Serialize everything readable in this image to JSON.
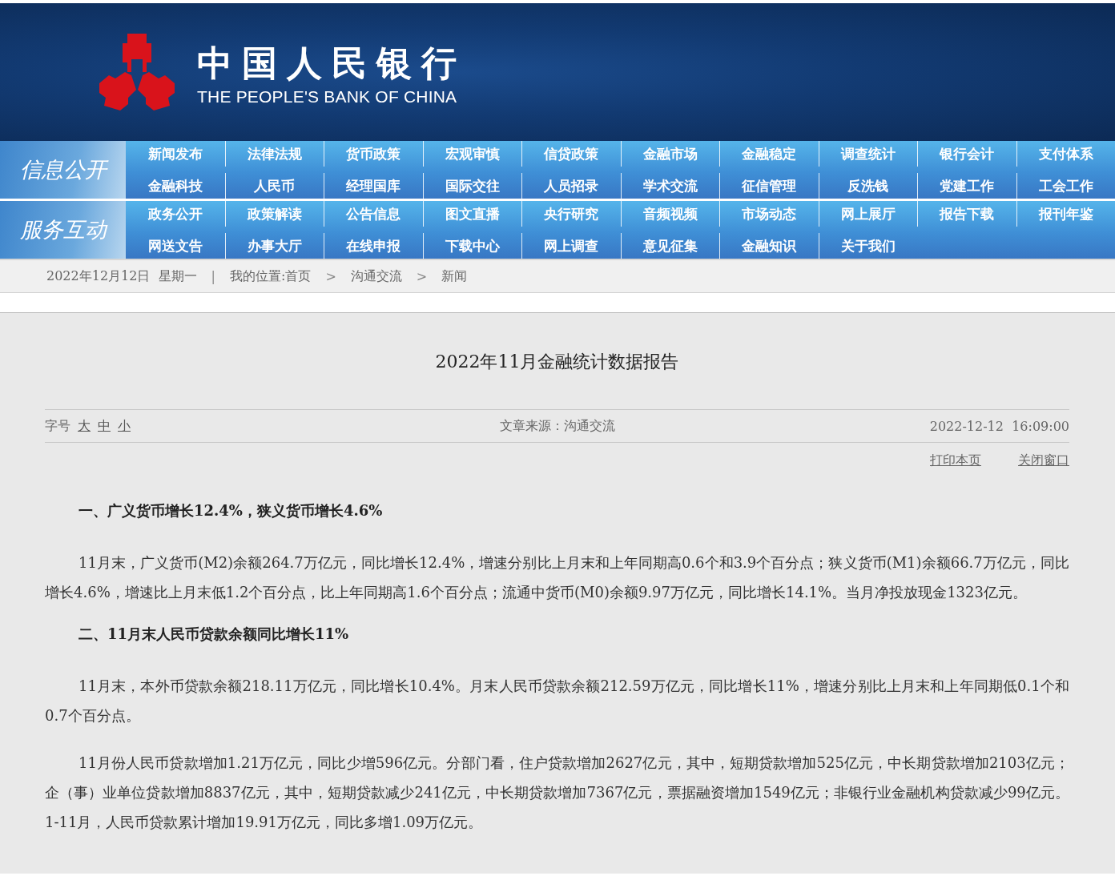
{
  "header": {
    "logo_cn": "中国人民银行",
    "logo_en": "THE PEOPLE'S BANK OF CHINA"
  },
  "nav": [
    {
      "label": "信息公开",
      "items": [
        "新闻发布",
        "法律法规",
        "货币政策",
        "宏观审慎",
        "信贷政策",
        "金融市场",
        "金融稳定",
        "调查统计",
        "银行会计",
        "支付体系",
        "金融科技",
        "人民币",
        "经理国库",
        "国际交往",
        "人员招录",
        "学术交流",
        "征信管理",
        "反洗钱",
        "党建工作",
        "工会工作"
      ]
    },
    {
      "label": "服务互动",
      "items": [
        "政务公开",
        "政策解读",
        "公告信息",
        "图文直播",
        "央行研究",
        "音频视频",
        "市场动态",
        "网上展厅",
        "报告下载",
        "报刊年鉴",
        "网送文告",
        "办事大厅",
        "在线申报",
        "下载中心",
        "网上调查",
        "意见征集",
        "金融知识",
        "关于我们"
      ]
    }
  ],
  "breadcrumb": {
    "date": "2022年12月12日  星期一",
    "divider": "|",
    "location_label": "我的位置:",
    "items": [
      "首页",
      "沟通交流",
      "新闻"
    ],
    "separators": [
      ">",
      ">"
    ]
  },
  "article": {
    "title": "2022年11月金融统计数据报告",
    "font_size_label": "字号",
    "font_sizes": [
      "大",
      "中",
      "小"
    ],
    "source": "文章来源：沟通交流",
    "time": "2022-12-12  16:09:00",
    "actions": [
      "打印本页",
      "关闭窗口"
    ],
    "blocks": [
      {
        "kind": "heading",
        "text": "一、广义货币增长12.4%，狭义货币增长4.6%"
      },
      {
        "kind": "paragraph",
        "text": "11月末，广义货币(M2)余额264.7万亿元，同比增长12.4%，增速分别比上月末和上年同期高0.6个和3.9个百分点；狭义货币(M1)余额66.7万亿元，同比增长4.6%，增速比上月末低1.2个百分点，比上年同期高1.6个百分点；流通中货币(M0)余额9.97万亿元，同比增长14.1%。当月净投放现金1323亿元。"
      },
      {
        "kind": "heading",
        "text": "二、11月末人民币贷款余额同比增长11%"
      },
      {
        "kind": "paragraph",
        "text": "11月末，本外币贷款余额218.11万亿元，同比增长10.4%。月末人民币贷款余额212.59万亿元，同比增长11%，增速分别比上月末和上年同期低0.1个和0.7个百分点。"
      },
      {
        "kind": "paragraph",
        "text": "11月份人民币贷款增加1.21万亿元，同比少增596亿元。分部门看，住户贷款增加2627亿元，其中，短期贷款增加525亿元，中长期贷款增加2103亿元；企（事）业单位贷款增加8837亿元，其中，短期贷款减少241亿元，中长期贷款增加7367亿元，票据融资增加1549亿元；非银行业金融机构贷款减少99亿元。1-11月，人民币贷款累计增加19.91万亿元，同比多增1.09万亿元。"
      }
    ]
  }
}
